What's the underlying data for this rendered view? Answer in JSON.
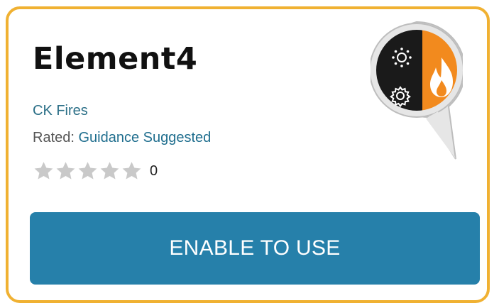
{
  "skill": {
    "title": "Element4",
    "developer": "CK Fires",
    "rated_label": "Rated:",
    "rating_value": "Guidance Suggested",
    "stars": 0,
    "review_count": "0",
    "enable_label": "ENABLE TO USE",
    "icon": "skill-icon-speech-bubble-sun-gear-flame"
  },
  "colors": {
    "card_border": "#f0b132",
    "button_bg": "#2680aa",
    "link": "#1f6e8e",
    "icon_dark": "#1a1a1a",
    "icon_orange": "#f28a1e",
    "star_empty": "#c9c9c9"
  }
}
